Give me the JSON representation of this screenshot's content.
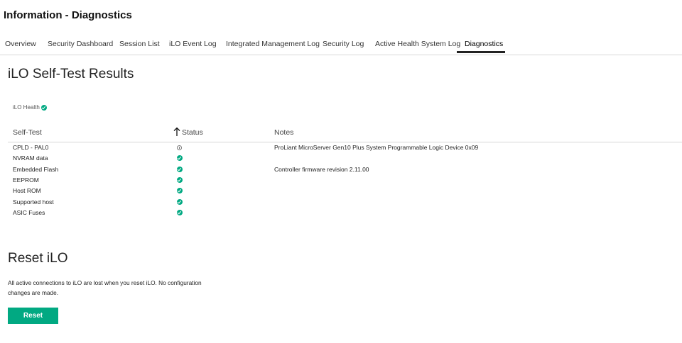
{
  "header": {
    "title": "Information - Diagnostics"
  },
  "tabs": [
    {
      "label": "Overview",
      "active": false
    },
    {
      "label": "Security Dashboard",
      "active": false
    },
    {
      "label": "Session List",
      "active": false
    },
    {
      "label": "iLO Event Log",
      "active": false
    },
    {
      "label": "Integrated Management Log",
      "active": false
    },
    {
      "label": "Security Log",
      "active": false
    },
    {
      "label": "Active Health System Log",
      "active": false
    },
    {
      "label": "Diagnostics",
      "active": true
    }
  ],
  "selftest": {
    "title": "iLO Self-Test Results",
    "health_label": "iLO Health",
    "health_icon": "check-circle-icon",
    "columns": {
      "test": "Self-Test",
      "status": "Status",
      "notes": "Notes"
    },
    "sort_icon": "arrow-up-icon",
    "rows": [
      {
        "test": "CPLD - PAL0",
        "status": "info",
        "notes": "ProLiant MicroServer Gen10 Plus System Programmable Logic Device 0x09"
      },
      {
        "test": "NVRAM data",
        "status": "ok",
        "notes": ""
      },
      {
        "test": "Embedded Flash",
        "status": "ok",
        "notes": "Controller firmware revision 2.11.00"
      },
      {
        "test": "EEPROM",
        "status": "ok",
        "notes": ""
      },
      {
        "test": "Host ROM",
        "status": "ok",
        "notes": ""
      },
      {
        "test": "Supported host",
        "status": "ok",
        "notes": ""
      },
      {
        "test": "ASIC Fuses",
        "status": "ok",
        "notes": ""
      }
    ]
  },
  "reset": {
    "title": "Reset iLO",
    "description": "All active connections to iLO are lost when you reset iLO. No configuration changes are made.",
    "button_label": "Reset"
  },
  "colors": {
    "accent": "#01a982",
    "active_tab_underline": "#222222",
    "divider": "#d7d7d7"
  }
}
